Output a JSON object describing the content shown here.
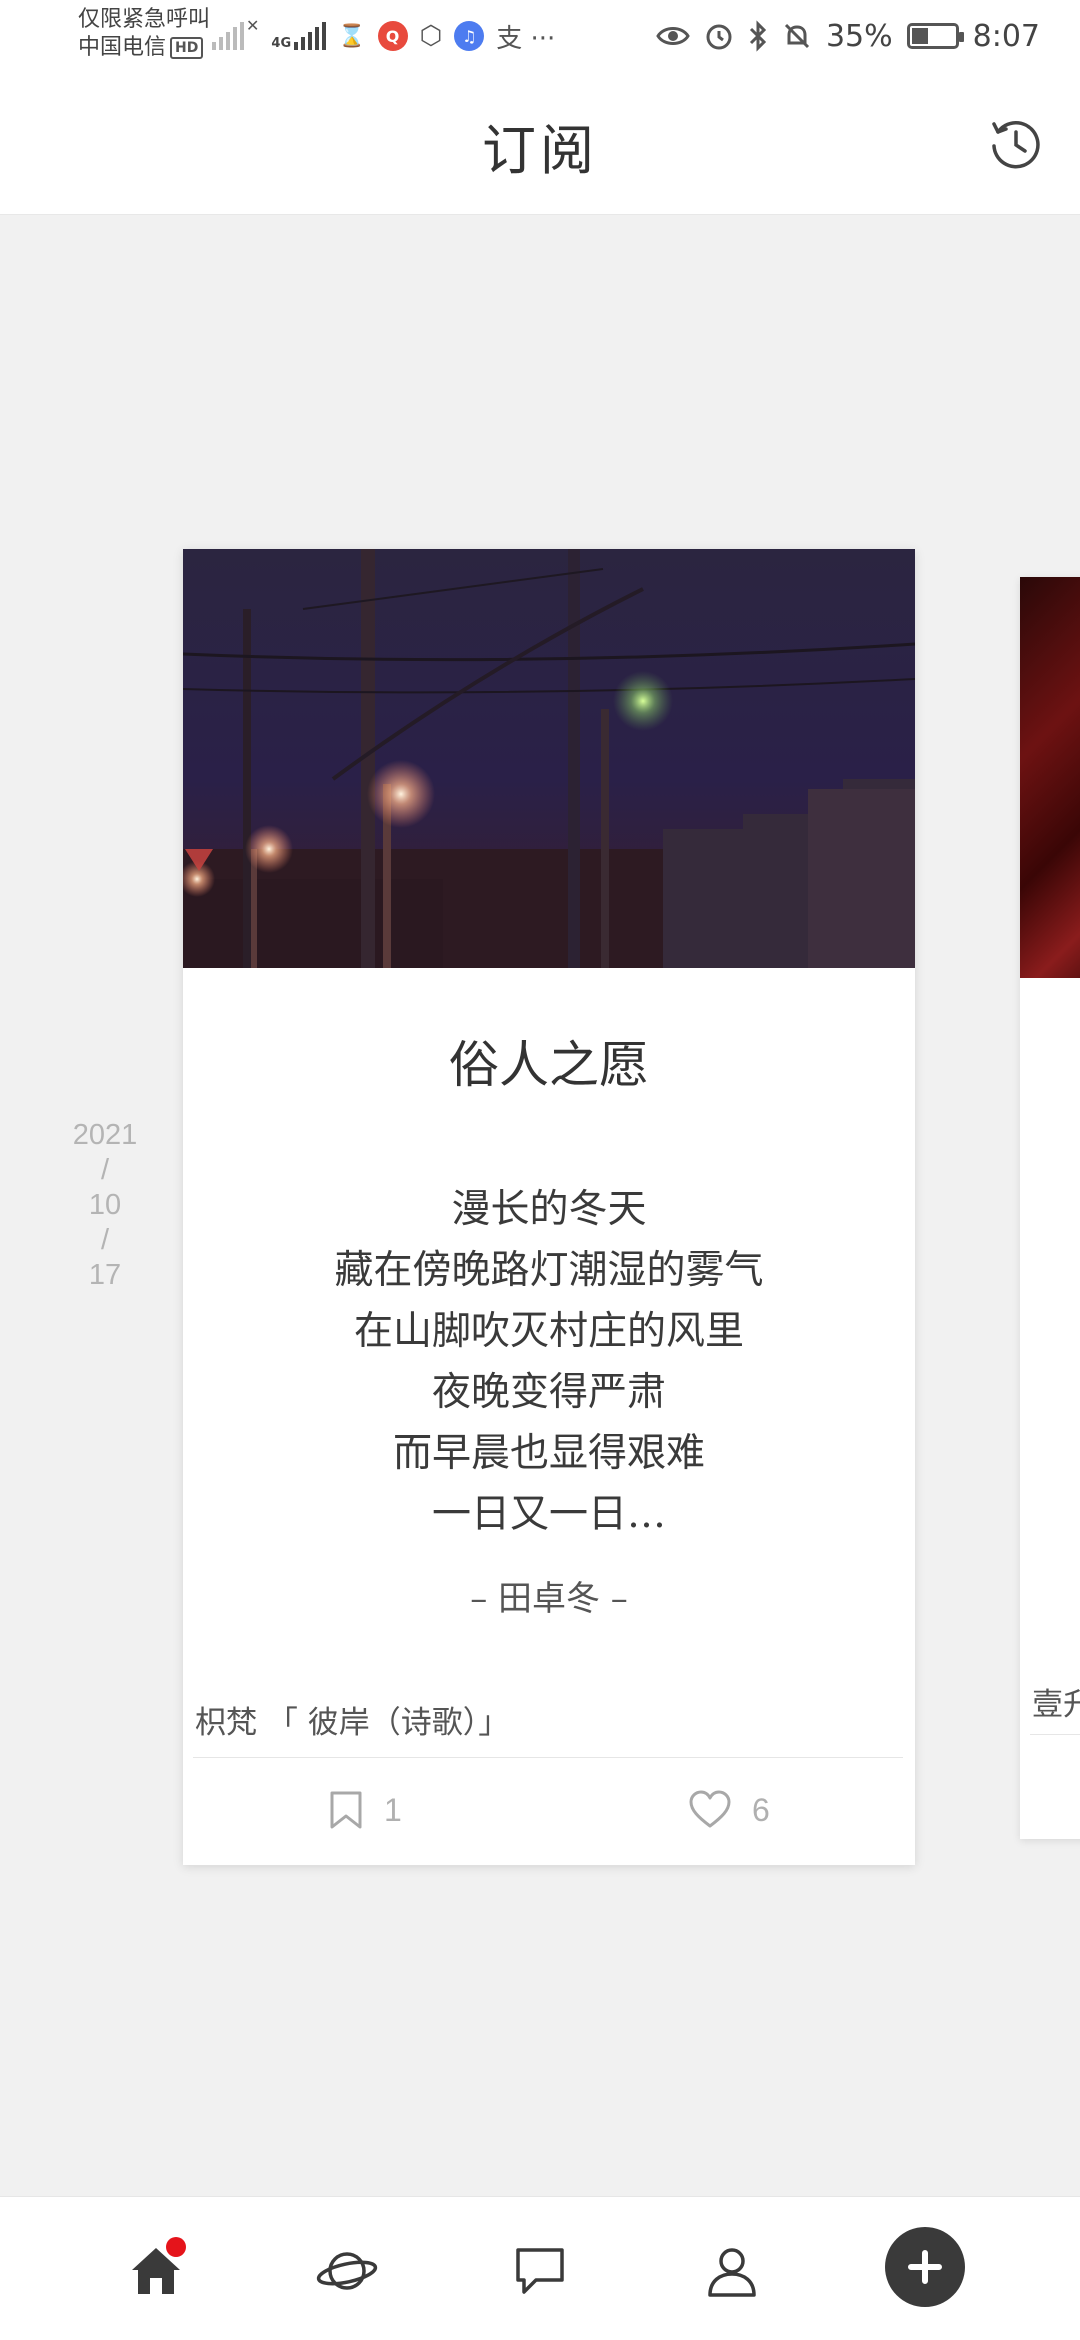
{
  "status_bar": {
    "carrier_line1": "仅限紧急呼叫",
    "carrier_line2": "中国电信",
    "hd_label": "HD",
    "network_label": "4G",
    "misc_glyphs": "支 ···",
    "battery_percent": "35%",
    "time": "8:07"
  },
  "header": {
    "title": "订阅"
  },
  "date": {
    "year": "2021",
    "sep1": "/",
    "month": "10",
    "sep2": "/",
    "day": "17"
  },
  "card": {
    "title": "俗人之愿",
    "poem_lines": [
      "漫长的冬天",
      "藏在傍晚路灯潮湿的雾气",
      "在山脚吹灭村庄的风里",
      "夜晚变得严肃",
      "而早晨也显得艰难",
      "一日又一日…"
    ],
    "author": "– 田卓冬 –",
    "meta": "枳梵 「 彼岸（诗歌）」",
    "save_count": "1",
    "like_count": "6"
  },
  "next_card": {
    "meta": "壹升"
  },
  "colors": {
    "badge": "#e5141b",
    "compose_button": "#3a3a3a",
    "page_background": "#f1f1f1"
  },
  "bottom_nav": {
    "items": [
      "home-icon",
      "explore-planet-icon",
      "messages-icon",
      "profile-icon",
      "compose-plus-icon"
    ]
  }
}
